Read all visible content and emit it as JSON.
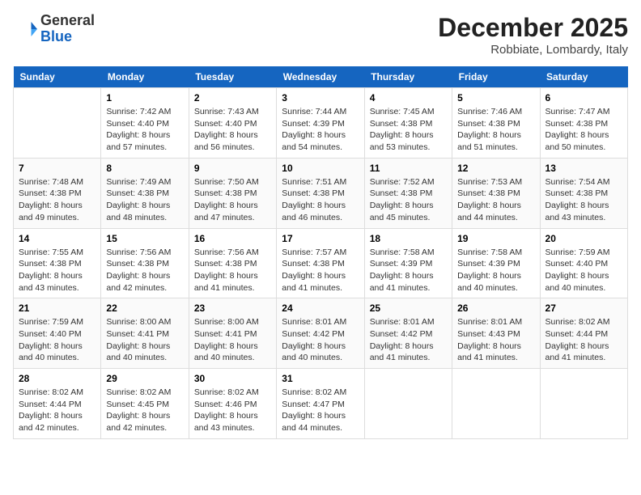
{
  "header": {
    "logo_general": "General",
    "logo_blue": "Blue",
    "month_title": "December 2025",
    "location": "Robbiate, Lombardy, Italy"
  },
  "days_of_week": [
    "Sunday",
    "Monday",
    "Tuesday",
    "Wednesday",
    "Thursday",
    "Friday",
    "Saturday"
  ],
  "weeks": [
    [
      {
        "day": null,
        "info": null
      },
      {
        "day": "1",
        "info": "Sunrise: 7:42 AM\nSunset: 4:40 PM\nDaylight: 8 hours\nand 57 minutes."
      },
      {
        "day": "2",
        "info": "Sunrise: 7:43 AM\nSunset: 4:40 PM\nDaylight: 8 hours\nand 56 minutes."
      },
      {
        "day": "3",
        "info": "Sunrise: 7:44 AM\nSunset: 4:39 PM\nDaylight: 8 hours\nand 54 minutes."
      },
      {
        "day": "4",
        "info": "Sunrise: 7:45 AM\nSunset: 4:38 PM\nDaylight: 8 hours\nand 53 minutes."
      },
      {
        "day": "5",
        "info": "Sunrise: 7:46 AM\nSunset: 4:38 PM\nDaylight: 8 hours\nand 51 minutes."
      },
      {
        "day": "6",
        "info": "Sunrise: 7:47 AM\nSunset: 4:38 PM\nDaylight: 8 hours\nand 50 minutes."
      }
    ],
    [
      {
        "day": "7",
        "info": "Sunrise: 7:48 AM\nSunset: 4:38 PM\nDaylight: 8 hours\nand 49 minutes."
      },
      {
        "day": "8",
        "info": "Sunrise: 7:49 AM\nSunset: 4:38 PM\nDaylight: 8 hours\nand 48 minutes."
      },
      {
        "day": "9",
        "info": "Sunrise: 7:50 AM\nSunset: 4:38 PM\nDaylight: 8 hours\nand 47 minutes."
      },
      {
        "day": "10",
        "info": "Sunrise: 7:51 AM\nSunset: 4:38 PM\nDaylight: 8 hours\nand 46 minutes."
      },
      {
        "day": "11",
        "info": "Sunrise: 7:52 AM\nSunset: 4:38 PM\nDaylight: 8 hours\nand 45 minutes."
      },
      {
        "day": "12",
        "info": "Sunrise: 7:53 AM\nSunset: 4:38 PM\nDaylight: 8 hours\nand 44 minutes."
      },
      {
        "day": "13",
        "info": "Sunrise: 7:54 AM\nSunset: 4:38 PM\nDaylight: 8 hours\nand 43 minutes."
      }
    ],
    [
      {
        "day": "14",
        "info": "Sunrise: 7:55 AM\nSunset: 4:38 PM\nDaylight: 8 hours\nand 43 minutes."
      },
      {
        "day": "15",
        "info": "Sunrise: 7:56 AM\nSunset: 4:38 PM\nDaylight: 8 hours\nand 42 minutes."
      },
      {
        "day": "16",
        "info": "Sunrise: 7:56 AM\nSunset: 4:38 PM\nDaylight: 8 hours\nand 41 minutes."
      },
      {
        "day": "17",
        "info": "Sunrise: 7:57 AM\nSunset: 4:38 PM\nDaylight: 8 hours\nand 41 minutes."
      },
      {
        "day": "18",
        "info": "Sunrise: 7:58 AM\nSunset: 4:39 PM\nDaylight: 8 hours\nand 41 minutes."
      },
      {
        "day": "19",
        "info": "Sunrise: 7:58 AM\nSunset: 4:39 PM\nDaylight: 8 hours\nand 40 minutes."
      },
      {
        "day": "20",
        "info": "Sunrise: 7:59 AM\nSunset: 4:40 PM\nDaylight: 8 hours\nand 40 minutes."
      }
    ],
    [
      {
        "day": "21",
        "info": "Sunrise: 7:59 AM\nSunset: 4:40 PM\nDaylight: 8 hours\nand 40 minutes."
      },
      {
        "day": "22",
        "info": "Sunrise: 8:00 AM\nSunset: 4:41 PM\nDaylight: 8 hours\nand 40 minutes."
      },
      {
        "day": "23",
        "info": "Sunrise: 8:00 AM\nSunset: 4:41 PM\nDaylight: 8 hours\nand 40 minutes."
      },
      {
        "day": "24",
        "info": "Sunrise: 8:01 AM\nSunset: 4:42 PM\nDaylight: 8 hours\nand 40 minutes."
      },
      {
        "day": "25",
        "info": "Sunrise: 8:01 AM\nSunset: 4:42 PM\nDaylight: 8 hours\nand 41 minutes."
      },
      {
        "day": "26",
        "info": "Sunrise: 8:01 AM\nSunset: 4:43 PM\nDaylight: 8 hours\nand 41 minutes."
      },
      {
        "day": "27",
        "info": "Sunrise: 8:02 AM\nSunset: 4:44 PM\nDaylight: 8 hours\nand 41 minutes."
      }
    ],
    [
      {
        "day": "28",
        "info": "Sunrise: 8:02 AM\nSunset: 4:44 PM\nDaylight: 8 hours\nand 42 minutes."
      },
      {
        "day": "29",
        "info": "Sunrise: 8:02 AM\nSunset: 4:45 PM\nDaylight: 8 hours\nand 42 minutes."
      },
      {
        "day": "30",
        "info": "Sunrise: 8:02 AM\nSunset: 4:46 PM\nDaylight: 8 hours\nand 43 minutes."
      },
      {
        "day": "31",
        "info": "Sunrise: 8:02 AM\nSunset: 4:47 PM\nDaylight: 8 hours\nand 44 minutes."
      },
      {
        "day": null,
        "info": null
      },
      {
        "day": null,
        "info": null
      },
      {
        "day": null,
        "info": null
      }
    ]
  ]
}
